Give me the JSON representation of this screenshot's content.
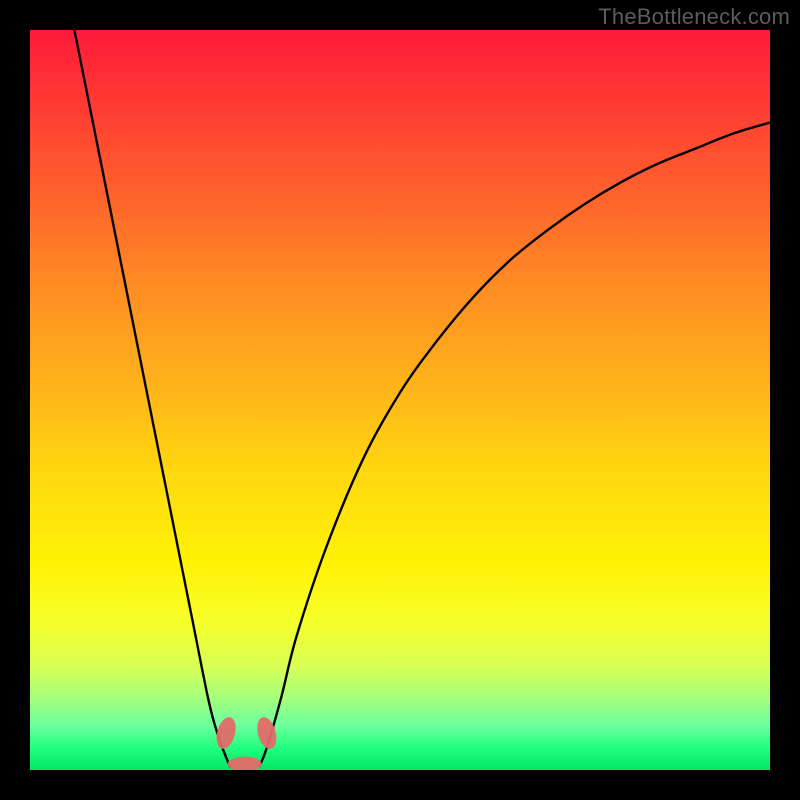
{
  "watermark": "TheBottleneck.com",
  "chart_data": {
    "type": "line",
    "title": "",
    "xlabel": "",
    "ylabel": "",
    "xlim": [
      0,
      100
    ],
    "ylim": [
      0,
      100
    ],
    "series": [
      {
        "name": "left-branch",
        "x": [
          6,
          8,
          10,
          12,
          14,
          16,
          18,
          20,
          22,
          24,
          25,
          26,
          27
        ],
        "y": [
          100,
          90,
          80,
          70,
          60,
          50,
          40,
          30,
          20,
          10,
          6,
          3,
          0.5
        ]
      },
      {
        "name": "right-branch",
        "x": [
          31,
          32,
          34,
          36,
          40,
          45,
          50,
          55,
          60,
          65,
          70,
          75,
          80,
          85,
          90,
          95,
          100
        ],
        "y": [
          0.5,
          3,
          10,
          18,
          30,
          42,
          51,
          58,
          64,
          69,
          73,
          76.5,
          79.5,
          82,
          84,
          86,
          87.5
        ]
      }
    ],
    "markers": [
      {
        "name": "blob-left",
        "cx": 26.5,
        "cy": 5,
        "rx": 1.2,
        "ry": 2.2,
        "rot": 15
      },
      {
        "name": "blob-right",
        "cx": 32.0,
        "cy": 5,
        "rx": 1.2,
        "ry": 2.2,
        "rot": -15
      },
      {
        "name": "blob-bottom",
        "cx": 29.0,
        "cy": 0.8,
        "rx": 2.3,
        "ry": 1.0,
        "rot": 0
      }
    ],
    "gradient_stops": [
      {
        "pos": 0,
        "color": "#ff1a3a"
      },
      {
        "pos": 50,
        "color": "#ffd80f"
      },
      {
        "pos": 80,
        "color": "#f6ff2a"
      },
      {
        "pos": 100,
        "color": "#00e765"
      }
    ]
  }
}
